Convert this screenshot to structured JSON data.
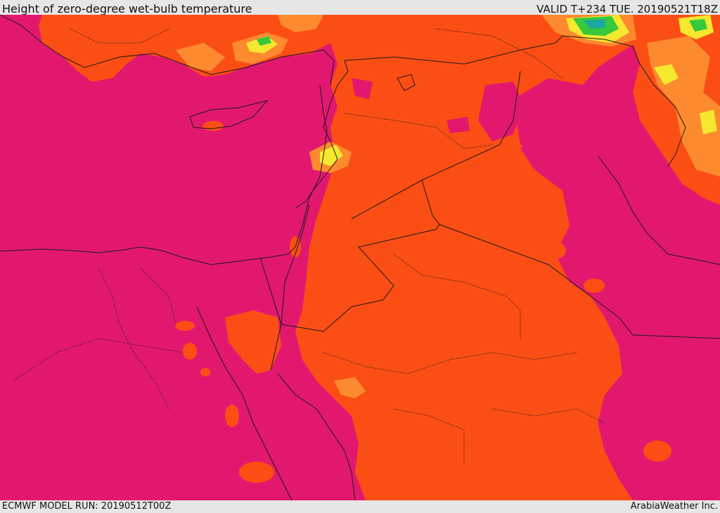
{
  "header": {
    "title": "Height of zero-degree wet-bulb temperature",
    "valid": "VALID T+234 TUE. 20190521T18Z"
  },
  "footer": {
    "model_run": "ECMWF MODEL RUN: 20190512T00Z",
    "credit": "ArabiaWeather Inc."
  },
  "colors": {
    "lowest_band": "#e2186e",
    "orange_band": "#fb4e15",
    "light_orange_band": "#fd8a2e",
    "yellow_band": "#f5e82e",
    "green_band": "#35c93b",
    "teal_band": "#1ca89e",
    "border": "#1a1a1a"
  }
}
